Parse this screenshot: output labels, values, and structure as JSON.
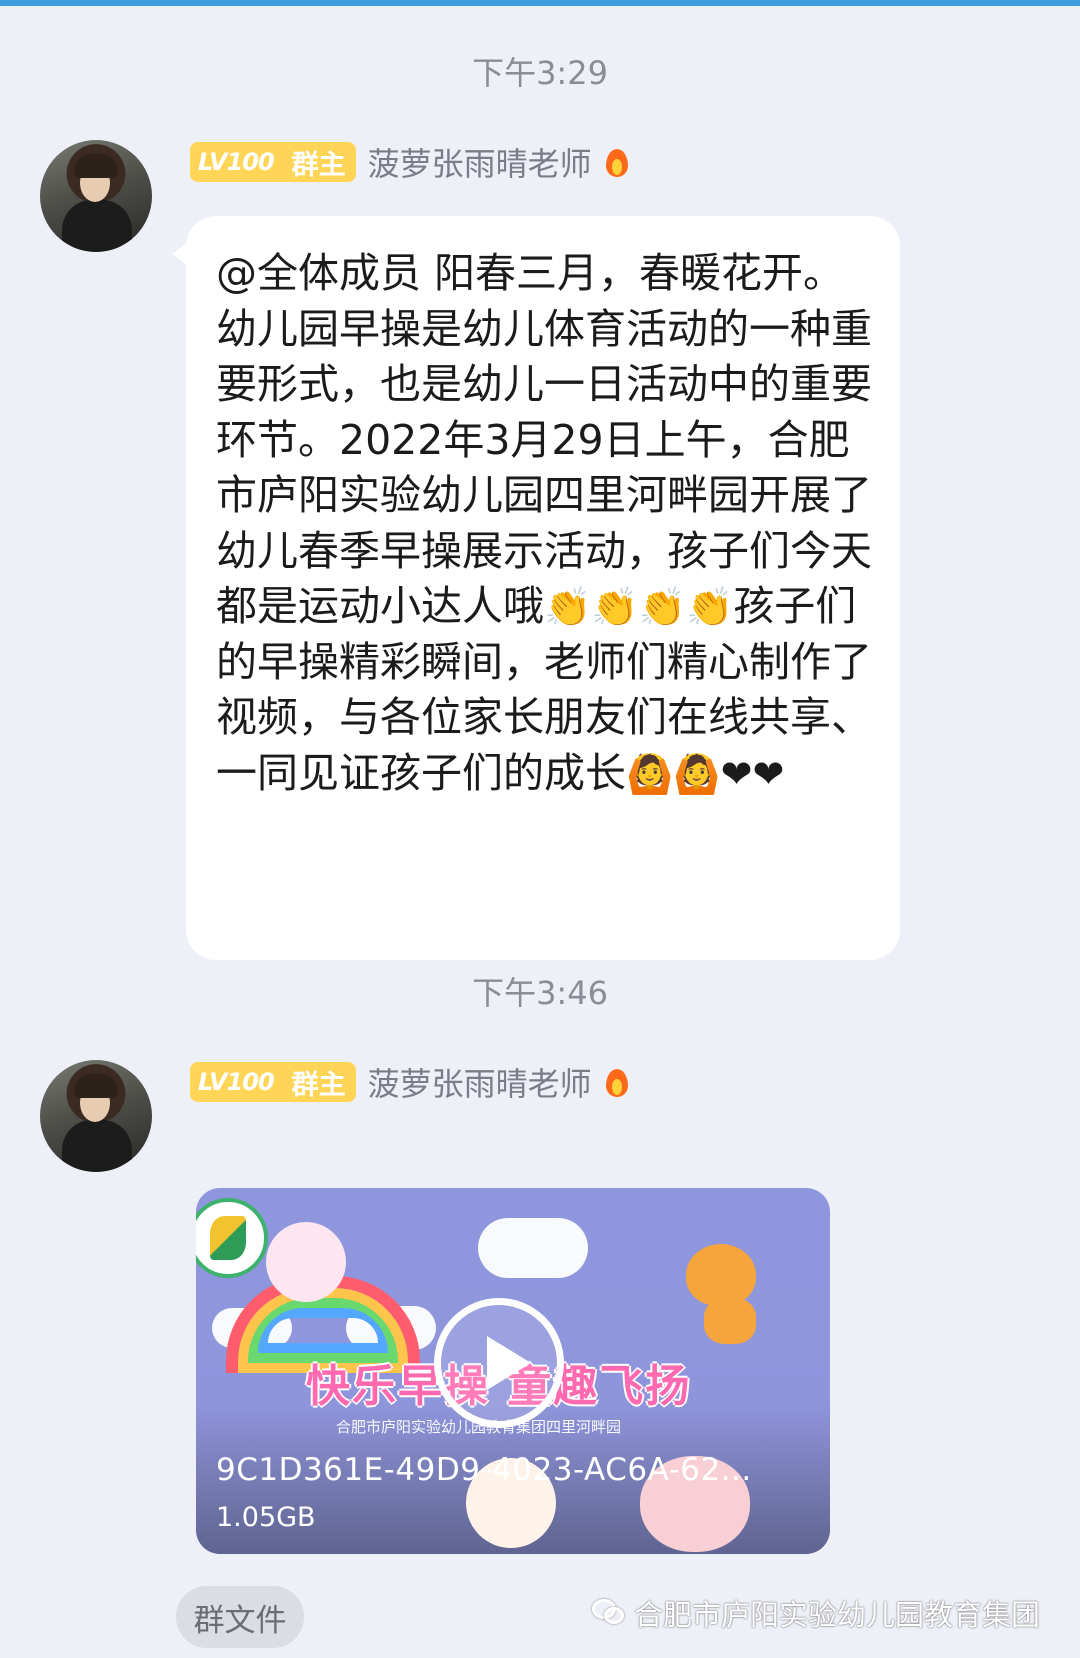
{
  "messages": [
    {
      "time": "下午3:29",
      "badge_level": "LV100",
      "badge_role": "群主",
      "sender": "菠萝张雨晴老师",
      "text_before_emoji1": "@全体成员 阳春三月，春暖花开。幼儿园早操是幼儿体育活动的一种重要形式，也是幼儿一日活动中的重要环节。2022年3月29日上午，合肥市庐阳实验幼儿园四里河畔园开展了幼儿春季早操展示活动，孩子们今天都是运动小达人哦",
      "emoji_clap": "👏👏👏👏",
      "text_middle": "孩子们的早操精彩瞬间，老师们精心制作了视频，与各位家长朋友们在线共享、一同见证孩子们的成长",
      "emoji_end": "🙆🙆❤❤"
    },
    {
      "time": "下午3:46",
      "badge_level": "LV100",
      "badge_role": "群主",
      "sender": "菠萝张雨晴老师",
      "video": {
        "title_art": "快乐早操 童趣飞扬",
        "subtitle_art": "合肥市庐阳实验幼儿园教育集团四里河畔园",
        "file_name": "9C1D361E-49D9-4023-AC6A-62...",
        "file_size": "1.05GB"
      }
    }
  ],
  "group_file_tag": "群文件",
  "watermark": "合肥市庐阳实验幼儿园教育集团",
  "colors": {
    "background": "#eef0f8",
    "badge": "#ffd557",
    "bubble": "#ffffff",
    "video_bg": "#8e97de"
  },
  "icons": [
    "fire-icon",
    "play-icon",
    "wechat-icon"
  ]
}
